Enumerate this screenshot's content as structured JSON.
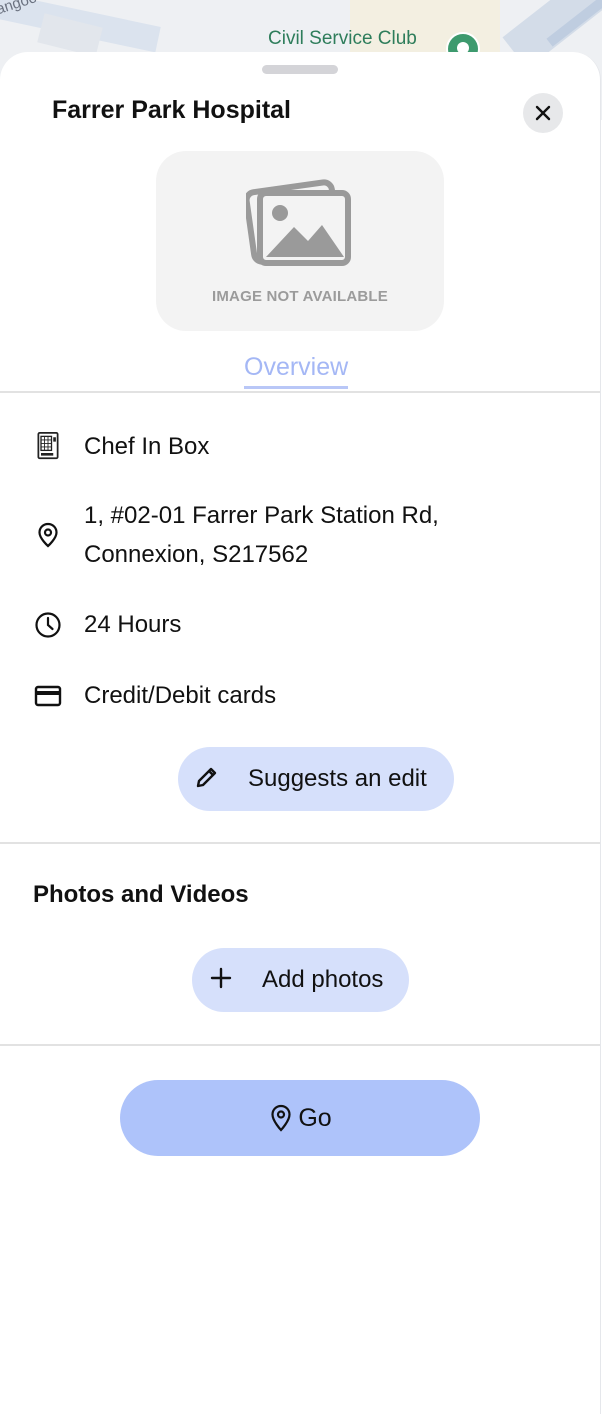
{
  "map": {
    "poi_label": "Civil Service Club",
    "street_fragment": "angoo"
  },
  "sheet": {
    "title": "Farrer Park Hospital",
    "image_placeholder_text": "IMAGE NOT AVAILABLE",
    "tabs": [
      {
        "label": "Overview",
        "active": true
      }
    ],
    "details": [
      {
        "icon": "vending-machine-icon",
        "text": "Chef In Box"
      },
      {
        "icon": "location-pin-icon",
        "text": "1, #02-01 Farrer Park Station Rd, Connexion, S217562"
      },
      {
        "icon": "clock-icon",
        "text": "24 Hours"
      },
      {
        "icon": "credit-card-icon",
        "text": "Credit/Debit cards"
      }
    ],
    "suggest_edit_label": "Suggests an edit",
    "photos_section": {
      "heading": "Photos and Videos",
      "add_photos_label": "Add photos"
    },
    "go_label": "Go"
  },
  "colors": {
    "accent_light": "#d6e0fb",
    "go_button": "#aec3fa",
    "tab_active": "#a4b7f5",
    "poi_green": "#2e7d5b"
  }
}
